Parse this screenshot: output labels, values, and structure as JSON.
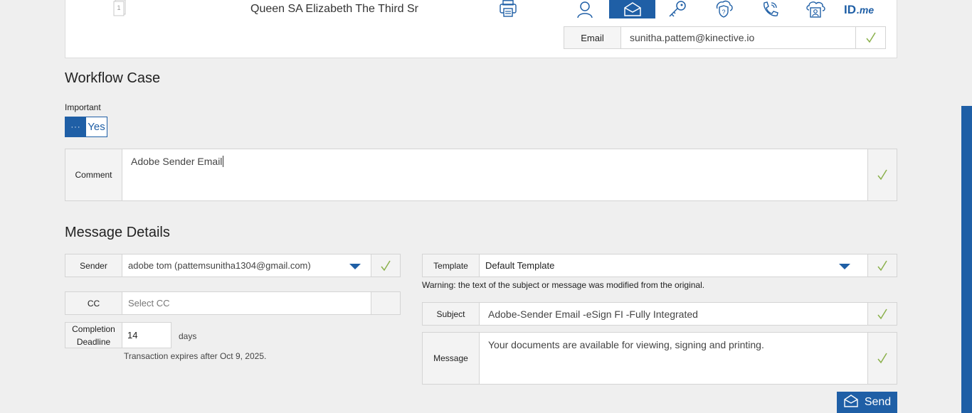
{
  "header": {
    "recipient_name": "Queen SA Elizabeth The Third Sr",
    "doc_badge": "1",
    "delivery_methods": [
      {
        "icon": "person-icon",
        "active": false
      },
      {
        "icon": "email-icon",
        "active": true
      },
      {
        "icon": "key-icon",
        "active": false
      },
      {
        "icon": "shield-question-icon",
        "active": false
      },
      {
        "icon": "phone-icon",
        "active": false
      },
      {
        "icon": "cloud-id-icon",
        "active": false
      }
    ],
    "idme_label": "ID",
    "idme_suffix": ".me",
    "email_label": "Email",
    "email_value": "sunitha.pattem@kinective.io"
  },
  "workflow": {
    "title": "Workflow Case",
    "important_label": "Important",
    "toggle_knob": "···",
    "toggle_value": "Yes",
    "comment_label": "Comment",
    "comment_value": "Adobe Sender Email"
  },
  "message": {
    "title": "Message Details",
    "sender_label": "Sender",
    "sender_value": "adobe tom (pattemsunitha1304@gmail.com)",
    "cc_label": "CC",
    "cc_placeholder": "Select CC",
    "deadline_label": "Completion Deadline",
    "deadline_value": "14",
    "days_label": "days",
    "expires_text": "Transaction expires after Oct 9, 2025.",
    "template_label": "Template",
    "template_value": "Default Template",
    "warning": "Warning: the text of the subject or message was modified from the original.",
    "subject_label": "Subject",
    "subject_value": "Adobe-Sender Email -eSign FI -Fully Integrated",
    "message_label": "Message",
    "message_value": "Your documents are available for viewing, signing and printing.",
    "send_label": "Send"
  },
  "colors": {
    "accent": "#1f5fa6",
    "check": "#8ab04a",
    "background": "#efefef"
  }
}
